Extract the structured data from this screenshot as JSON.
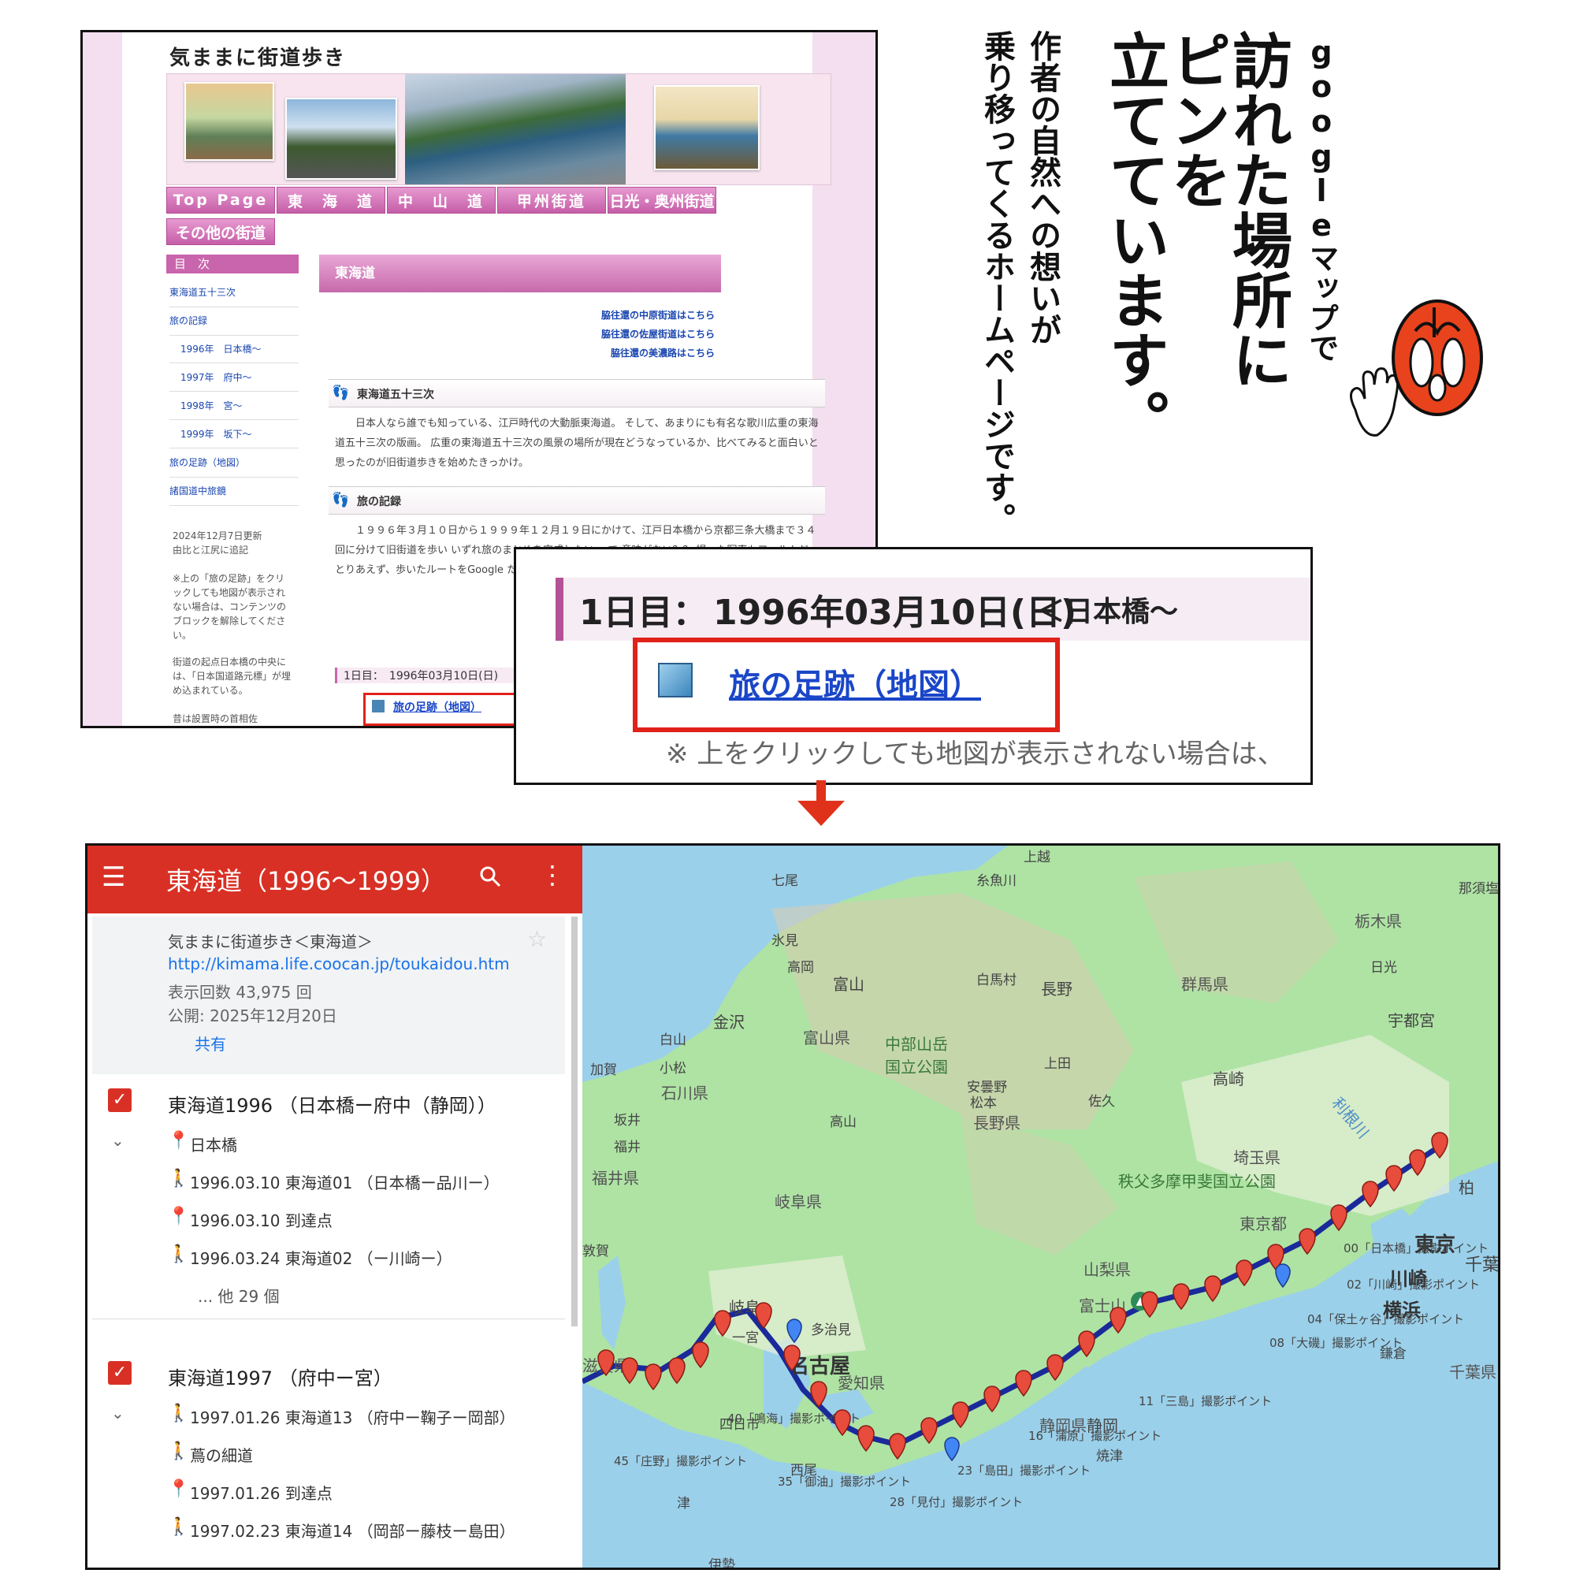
{
  "website": {
    "site_title": "気ままに街道歩き",
    "nav": [
      "Top Page",
      "東　海　道",
      "中　山　道",
      "甲州街道",
      "日光・奥州街道",
      "その他の街道"
    ],
    "sidebar_title": "目　次",
    "sidebar_items": [
      "東海道五十三次",
      "旅の記録",
      "1996年　日本橋〜",
      "1997年　府中〜",
      "1998年　宮〜",
      "1999年　坂下〜",
      "旅の足跡（地図）",
      "諸国道中旅鏡"
    ],
    "sidebar_notes": [
      "2024年12月7日更新",
      "由比と江尻に追記",
      "※上の「旅の足跡」をクリックしても地図が表示されない場合は、コンテンツのブロックを解除してください。",
      "街道の起点日本橋の中央には、「日本国道路元標」が埋め込まれている。",
      "昔は設置時の首相佐"
    ],
    "main_title": "東海道",
    "right_links": [
      "脇往還の中原街道はこちら",
      "脇往還の佐屋街道はこちら",
      "脇往還の美濃路はこちら"
    ],
    "section1_title": "東海道五十三次",
    "section1_text": "日本人なら誰でも知っている、江戸時代の大動脈東海道。 そして、あまりにも有名な歌川広重の東海道五十三次の版画。 広重の東海道五十三次の風景の場所が現在どうなっているか、比べてみると面白いと思ったのが旧街道歩きを始めたきっかけ。",
    "section2_title": "旅の記録",
    "section2_text": "１９９６年３月１０日から１９９９年１２月１９日にかけて、江戸日本橋から京都三条大橋まで３４回に分けて旧街道を歩い いずれ旅のまとめを完成したい。 で 意味がない？？ 撮った写真もフィルムだ とりあえず、歩いたルートをGoogle た。 また、広重の版画と街道で撮った写 カード)。",
    "day_line": "1日目：　1996年03月10日(日)",
    "map_link": "旅の足跡（地図）"
  },
  "zoom": {
    "day_label": "1日目：",
    "day_date": "1996年03月10日(日)",
    "day_suffix": "＜日本橋〜",
    "link": "旅の足跡（地図）",
    "note": "※ 上をクリックしても地図が表示されない場合は、"
  },
  "caption": {
    "line1": "googleマップで",
    "line2": "訪れた場所に",
    "line3": "ピンを",
    "line4": "立てています。",
    "line5": "作者の自然への想いが",
    "line6": "乗り移ってくるホームページです。"
  },
  "gmap": {
    "title": "東海道（1996〜1999）",
    "info_title": "気ままに街道歩き＜東海道＞",
    "info_url": "http://kimama.life.coocan.jp/toukaidou.htm",
    "info_views": "表示回数 43,975 回",
    "info_published": "公開: 2025年12月20日",
    "share": "共有",
    "layers": [
      {
        "title": "東海道1996 （日本橋ー府中（静岡））",
        "items": [
          {
            "icon": "pin",
            "text": "日本橋"
          },
          {
            "icon": "walk",
            "text": "1996.03.10 東海道01 （日本橋ー品川ー）"
          },
          {
            "icon": "pin",
            "text": "1996.03.10 到達点"
          },
          {
            "icon": "walk",
            "text": "1996.03.24 東海道02 （ー川崎ー）"
          },
          {
            "icon": "none",
            "text": "... 他 29 個"
          }
        ]
      },
      {
        "title": "東海道1997 （府中ー宮）",
        "items": [
          {
            "icon": "walk",
            "text": "1997.01.26 東海道13 （府中ー鞠子ー岡部）"
          },
          {
            "icon": "walk",
            "text": "蔦の細道"
          },
          {
            "icon": "pin",
            "text": "1997.01.26 到達点"
          },
          {
            "icon": "walk",
            "text": "1997.02.23 東海道14 （岡部ー藤枝ー島田）"
          }
        ]
      }
    ],
    "map_labels": {
      "cities": [
        "上越",
        "七尾",
        "糸魚川",
        "氷見",
        "高岡",
        "富山",
        "白馬村",
        "長野",
        "金沢",
        "白山",
        "小松",
        "上田",
        "安曇野",
        "松本",
        "佐久",
        "高崎",
        "坂井",
        "福井",
        "高山",
        "日光",
        "宇都宮",
        "那須塩原",
        "加賀",
        "岐阜",
        "一宮",
        "多治見",
        "名古屋",
        "四日市",
        "西尾",
        "津",
        "伊勢",
        "静岡",
        "焼津",
        "鎌倉",
        "柏",
        "千葉",
        "川崎",
        "横浜",
        "東京",
        "敦賀"
      ],
      "prefs": [
        "栃木県",
        "群馬県",
        "富山県",
        "石川県",
        "長野県",
        "埼玉県",
        "福井県",
        "岐阜県",
        "東京都",
        "山梨県",
        "愛知県",
        "滋賀県",
        "千葉県",
        "静岡県"
      ],
      "parks": [
        "中部山岳国立公園",
        "秩父多摩甲斐国立公園"
      ],
      "mountain": "富士山",
      "river": "利根川",
      "photo_points": [
        "00「日本橋」撮影ポイント",
        "02「川崎」撮影ポイント",
        "11「三島」撮影ポイント",
        "16「蒲原」撮影ポイント",
        "23「島田」撮影ポイント",
        "28「見付」撮影ポイント",
        "35「御油」撮影ポイント",
        "40「鳴海」撮影ポイント",
        "45「庄野」撮影ポイント",
        "08「大磯」撮影ポイント",
        "04「保土ヶ谷」撮影ポイント"
      ]
    }
  }
}
